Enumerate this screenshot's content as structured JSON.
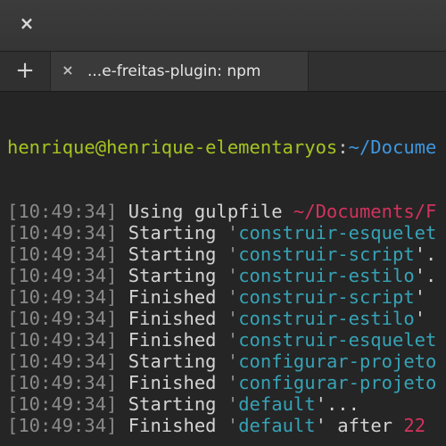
{
  "window": {
    "close_glyph": "×"
  },
  "tabbar": {
    "new_tab_glyph": "+",
    "tabs": [
      {
        "close_glyph": "×",
        "label": "...e-freitas-plugin: npm"
      }
    ]
  },
  "terminal": {
    "prompt": {
      "user_host": "henrique@henrique-elementaryos",
      "separator": ":",
      "path": "~/Docume"
    },
    "lines": [
      {
        "ts": "[10:49:34]",
        "word": "Using gulpfile",
        "path": "~/Documents/F"
      },
      {
        "ts": "[10:49:34]",
        "word": "Starting",
        "task": "construir-esquelet"
      },
      {
        "ts": "[10:49:34]",
        "word": "Starting",
        "task": "construir-script",
        "tail": "'."
      },
      {
        "ts": "[10:49:34]",
        "word": "Starting",
        "task": "construir-estilo",
        "tail": "'."
      },
      {
        "ts": "[10:49:34]",
        "word": "Finished",
        "task": "construir-script",
        "tail": "'"
      },
      {
        "ts": "[10:49:34]",
        "word": "Finished",
        "task": "construir-estilo",
        "tail": "'"
      },
      {
        "ts": "[10:49:34]",
        "word": "Finished",
        "task": "construir-esquelet"
      },
      {
        "ts": "[10:49:34]",
        "word": "Starting",
        "task": "configurar-projeto"
      },
      {
        "ts": "[10:49:34]",
        "word": "Finished",
        "task": "configurar-projeto"
      },
      {
        "ts": "[10:49:34]",
        "word": "Starting",
        "task": "default",
        "tail": "'..."
      },
      {
        "ts": "[10:49:34]",
        "word": "Finished",
        "task": "default",
        "tail": "' after",
        "num": "22"
      }
    ]
  },
  "colors": {
    "prompt_user": "#a6c421",
    "prompt_path": "#3e97e0",
    "task": "#36a3b6",
    "path": "#d3325d",
    "timestamp": "#8a8a8a"
  }
}
